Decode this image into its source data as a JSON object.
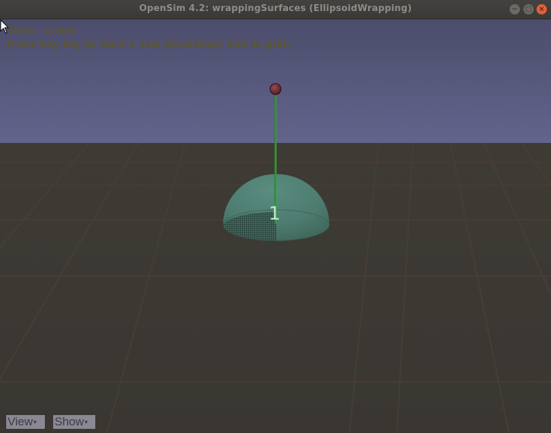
{
  "window": {
    "title": "OpenSim 4.2: wrappingSurfaces (EllipsoidWrapping)",
    "controls": {
      "minimize_glyph": "−",
      "maximize_glyph": "□",
      "close_glyph": "×"
    }
  },
  "overlay": {
    "time_label": "Time:",
    "time_value": "0.606",
    "hint": "Press any key to start a new simulation; ESC to quit."
  },
  "scene": {
    "wrap_body_label": "1"
  },
  "menus": {
    "view_label": "View",
    "show_label": "Show",
    "caret": "▾"
  },
  "colors": {
    "sky_top": "#4e4f6e",
    "sky_bottom": "#5f6189",
    "ground": "#3d3a34",
    "grid_line": "#4a3c36",
    "ellipsoid": "#4f7f72",
    "muscle": "#2b8a2b",
    "marker": "#7a2e33"
  }
}
